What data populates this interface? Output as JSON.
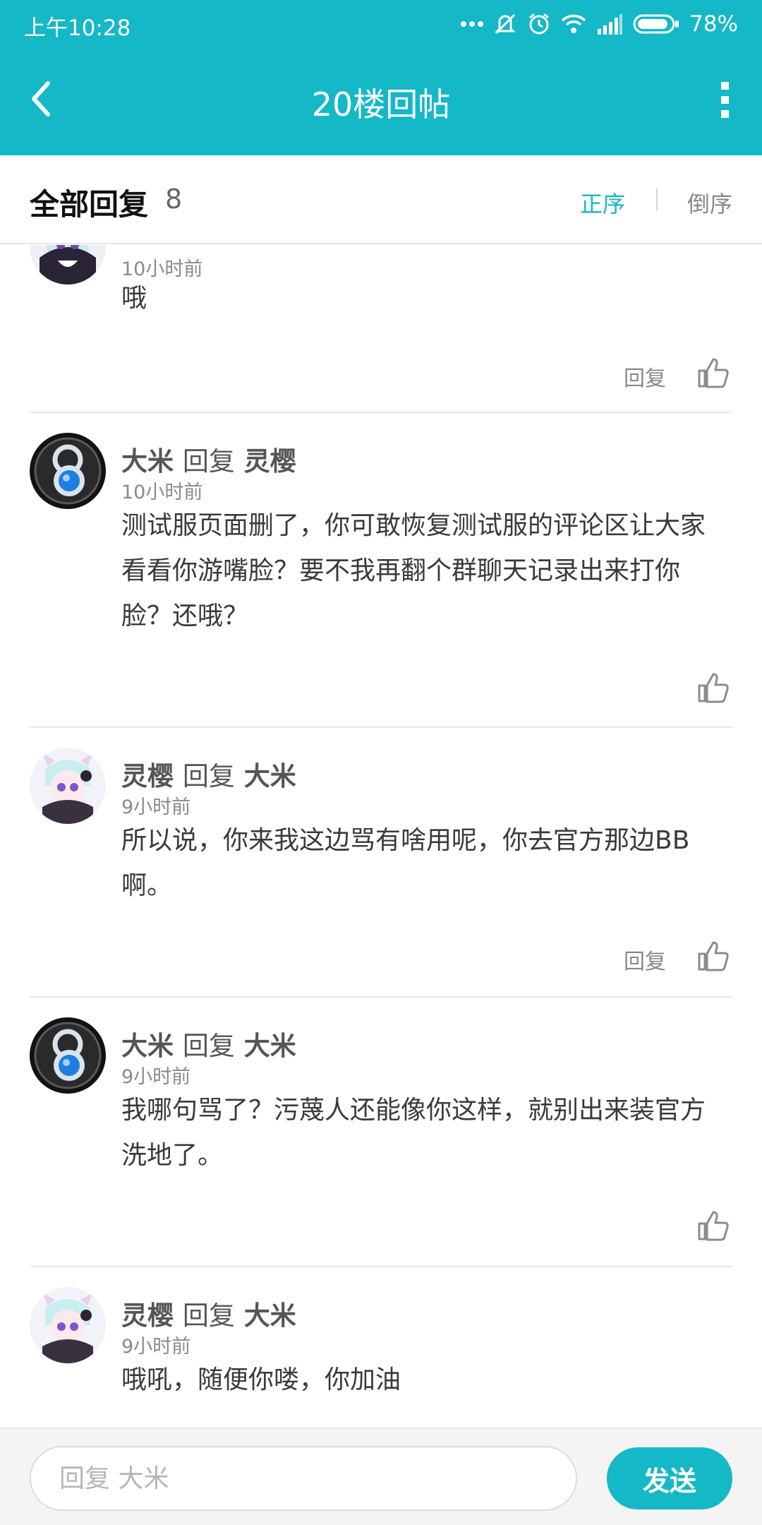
{
  "status_bar": {
    "time": "上午10:28",
    "battery": "78%",
    "icons": [
      "more-dots-icon",
      "mute-icon",
      "alarm-icon",
      "wifi-icon",
      "signal-icon",
      "battery-icon"
    ]
  },
  "nav": {
    "title": "20楼回帖",
    "back_icon": "chevron-left-icon",
    "more_icon": "more-vertical-icon"
  },
  "sort_bar": {
    "title": "全部回复",
    "count": "8",
    "asc_label": "正序",
    "desc_label": "倒序",
    "active": "正序"
  },
  "replies": [
    {
      "author": "",
      "verb": "",
      "target": "",
      "avatar": "anime-avatar",
      "time": "10小时前",
      "text": "哦",
      "reply_label": "回复",
      "has_reply": true
    },
    {
      "author": "大米",
      "verb": "回复",
      "target": "灵樱",
      "avatar": "robot-avatar",
      "time": "10小时前",
      "text": "测试服页面删了，你可敢恢复测试服的评论区让大家看看你游嘴脸？要不我再翻个群聊天记录出来打你脸？还哦？",
      "reply_label": "",
      "has_reply": false
    },
    {
      "author": "灵樱",
      "verb": "回复",
      "target": "大米",
      "avatar": "anime-avatar",
      "time": "9小时前",
      "text": "所以说，你来我这边骂有啥用呢，你去官方那边BB啊。",
      "reply_label": "回复",
      "has_reply": true
    },
    {
      "author": "大米",
      "verb": "回复",
      "target": "大米",
      "avatar": "robot-avatar",
      "time": "9小时前",
      "text": "我哪句骂了？污蔑人还能像你这样，就别出来装官方洗地了。",
      "reply_label": "",
      "has_reply": false
    },
    {
      "author": "灵樱",
      "verb": "回复",
      "target": "大米",
      "avatar": "anime-avatar",
      "time": "9小时前",
      "text": "哦吼，随便你喽，你加油",
      "reply_label": "",
      "has_reply": false
    }
  ],
  "composer": {
    "placeholder": "回复 大米",
    "send_label": "发送"
  },
  "colors": {
    "accent": "#14b8c6",
    "text_primary": "#3a3a3a",
    "text_secondary": "#8a8a8a",
    "divider": "#e8e8e8"
  }
}
